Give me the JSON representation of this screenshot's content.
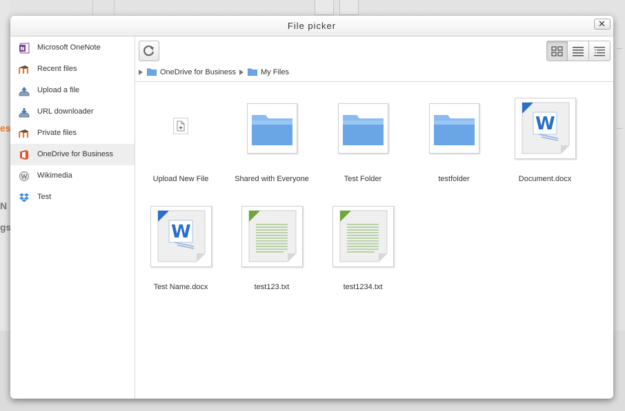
{
  "dialog": {
    "title": "File picker",
    "close_glyph": "✕"
  },
  "sidebar": {
    "items": [
      {
        "label": "Microsoft OneNote",
        "icon": "onenote-icon",
        "active": false
      },
      {
        "label": "Recent files",
        "icon": "moodle-icon",
        "active": false
      },
      {
        "label": "Upload a file",
        "icon": "upload-icon",
        "active": false
      },
      {
        "label": "URL downloader",
        "icon": "url-download-icon",
        "active": false
      },
      {
        "label": "Private files",
        "icon": "moodle-icon",
        "active": false
      },
      {
        "label": "OneDrive for Business",
        "icon": "office-icon",
        "active": true
      },
      {
        "label": "Wikimedia",
        "icon": "wikimedia-icon",
        "active": false
      },
      {
        "label": "Test",
        "icon": "dropbox-icon",
        "active": false
      }
    ]
  },
  "toolbar": {
    "refresh_icon": "refresh-icon",
    "views": [
      {
        "icon": "icon-view-icon",
        "active": true
      },
      {
        "icon": "list-view-icon",
        "active": false
      },
      {
        "icon": "tree-view-icon",
        "active": false
      }
    ]
  },
  "breadcrumb": [
    "OneDrive for Business",
    "My Files"
  ],
  "files": [
    {
      "name": "Upload New File",
      "type": "upload"
    },
    {
      "name": "Shared with Everyone",
      "type": "folder"
    },
    {
      "name": "Test Folder",
      "type": "folder"
    },
    {
      "name": "testfolder",
      "type": "folder"
    },
    {
      "name": "Document.docx",
      "type": "docx"
    },
    {
      "name": "Test Name.docx",
      "type": "docx"
    },
    {
      "name": "test123.txt",
      "type": "txt"
    },
    {
      "name": "test1234.txt",
      "type": "txt"
    }
  ],
  "background": {
    "fragments": [
      "es",
      "N",
      "gs"
    ],
    "accent_color": "#e8792b"
  },
  "colors": {
    "folder_blue": "#6aa5e6",
    "word_blue": "#2a6fc9",
    "txt_green": "#6ea83a"
  }
}
